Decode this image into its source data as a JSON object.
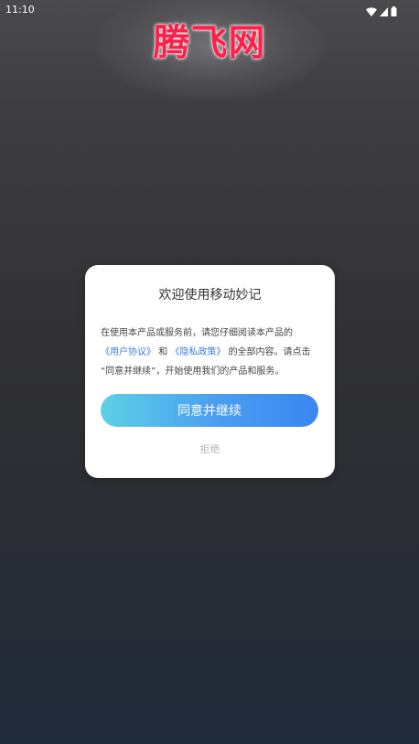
{
  "status_bar": {
    "time": "11:10",
    "icons": [
      "wifi-icon",
      "signal-icon",
      "battery-icon"
    ]
  },
  "watermark": {
    "text": "腾飞网",
    "color": "#ff1f4a"
  },
  "dialog": {
    "title": "欢迎使用移动妙记",
    "body": {
      "part1": "在使用本产品或服务前，请您仔细阅读本产品的",
      "link_user_agreement": "《用户协议》",
      "and": "和",
      "link_privacy_policy": "《隐私政策》",
      "part2": "的全部内容。请点击",
      "part3": "“同意并继续”，开始使用我们的产品和服务。"
    },
    "agree_label": "同意并继续",
    "reject_label": "拒绝",
    "link_color": "#3d7be0",
    "button_gradient": [
      "#5dd0e6",
      "#3a86f2"
    ]
  }
}
